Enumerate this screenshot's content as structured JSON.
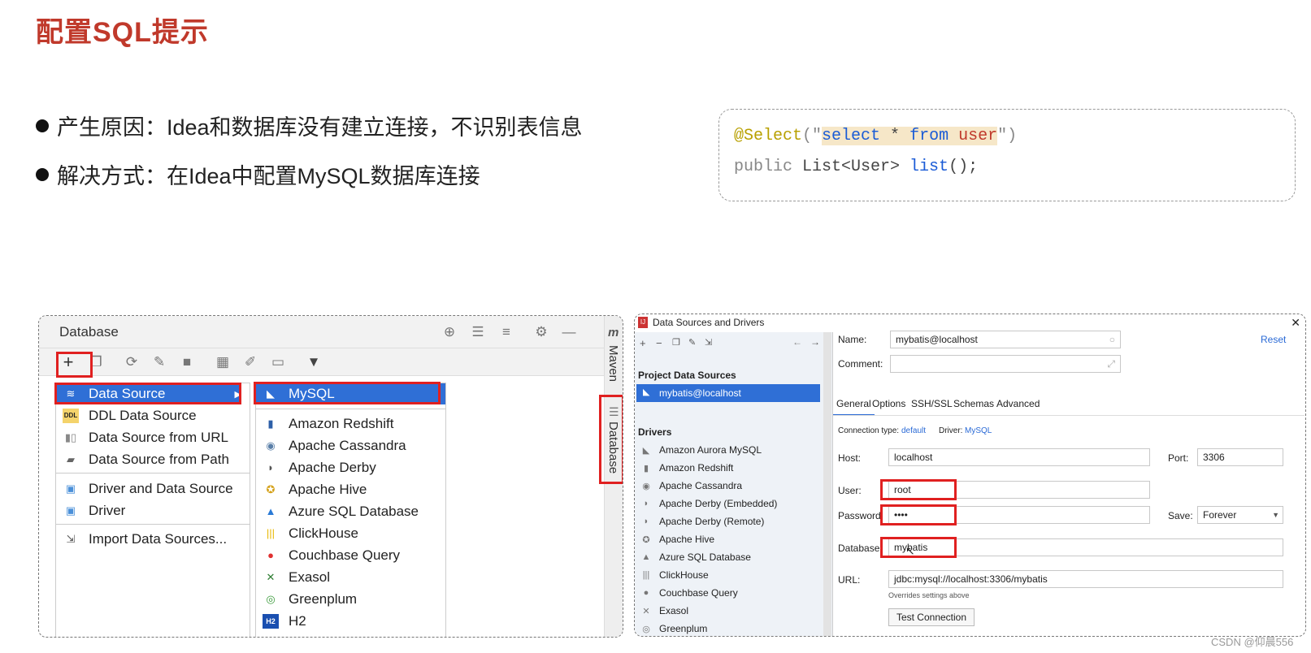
{
  "slide": {
    "title": "配置SQL提示",
    "bullets": [
      "产生原因：Idea和数据库没有建立连接，不识别表信息",
      "解决方式：在Idea中配置MySQL数据库连接"
    ],
    "code": {
      "line1_annotation": "@Select",
      "line1_open": "(\"",
      "line1_kw1": "select",
      "line1_star": " * ",
      "line1_kw2": "from",
      "line1_space": " ",
      "line1_table": "user",
      "line1_close": "\")",
      "line2_public": "public",
      "line2_type": " List<User> ",
      "line2_method": "list",
      "line2_end": "();"
    }
  },
  "db_panel": {
    "title": "Database",
    "side_tabs": [
      "Maven",
      "Database"
    ],
    "menu_items": [
      "Data Source",
      "DDL Data Source",
      "Data Source from URL",
      "Data Source from Path",
      "Driver and Data Source",
      "Driver",
      "Import Data Sources..."
    ],
    "submenu_items": [
      "MySQL",
      "Amazon Redshift",
      "Apache Cassandra",
      "Apache Derby",
      "Apache Hive",
      "Azure SQL Database",
      "ClickHouse",
      "Couchbase Query",
      "Exasol",
      "Greenplum",
      "H2"
    ]
  },
  "dialog": {
    "title": "Data Sources and Drivers",
    "project_sources_header": "Project Data Sources",
    "project_source": "mybatis@localhost",
    "drivers_header": "Drivers",
    "drivers": [
      "Amazon Aurora MySQL",
      "Amazon Redshift",
      "Apache Cassandra",
      "Apache Derby (Embedded)",
      "Apache Derby (Remote)",
      "Apache Hive",
      "Azure SQL Database",
      "ClickHouse",
      "Couchbase Query",
      "Exasol",
      "Greenplum"
    ],
    "name_label": "Name:",
    "name_value": "mybatis@localhost",
    "reset": "Reset",
    "comment_label": "Comment:",
    "tabs": [
      "General",
      "Options",
      "SSH/SSL",
      "Schemas",
      "Advanced"
    ],
    "conn_type_label": "Connection type:",
    "conn_type_value": "default",
    "driver_label": "Driver:",
    "driver_value": "MySQL",
    "host_label": "Host:",
    "host_value": "localhost",
    "port_label": "Port:",
    "port_value": "3306",
    "user_label": "User:",
    "user_value": "root",
    "password_label": "Password:",
    "password_value": "••••",
    "save_label": "Save:",
    "save_value": "Forever",
    "database_label": "Database:",
    "database_value": "mybatis",
    "url_label": "URL:",
    "url_value": "jdbc:mysql://localhost:3306/mybatis",
    "overrides_note": "Overrides settings above",
    "test_button": "Test Connection"
  },
  "watermark": "CSDN @仰晨556",
  "colors": {
    "accent_red": "#c0392b",
    "select_blue": "#2f6fd6",
    "highlight_red": "#e02020"
  }
}
